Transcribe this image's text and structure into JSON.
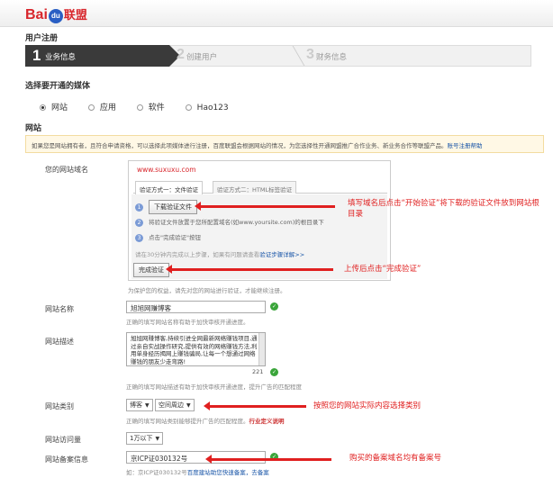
{
  "brand": {
    "logo_text_a": "Bai",
    "logo_paw": "du",
    "logo_cn": "联盟"
  },
  "page_title": "用户注册",
  "steps": [
    {
      "num": "1",
      "label": "业务信息"
    },
    {
      "num": "2",
      "label": "创建用户"
    },
    {
      "num": "3",
      "label": "财务信息"
    }
  ],
  "media": {
    "title": "选择要开通的媒体",
    "options": [
      "网站",
      "应用",
      "软件",
      "Hao123"
    ],
    "selected": "网站"
  },
  "site": {
    "title": "网站",
    "notice": "如果您是网站拥有者，且符合申请资格，可以选择此项媒体进行注册，百度联盟会根据网站的情况，为您选择性开通网盟推广合作业务、新业务合作等联盟产品。",
    "notice_link": "账号注册帮助"
  },
  "domain_field": {
    "label": "您的网站域名",
    "url": "www.suxuxu.com",
    "tab1": "验证方式一：文件验证",
    "tab2": "验证方式二：HTML标签验证",
    "step1_num": "1",
    "step1_button": "下载验证文件",
    "step2_num": "2",
    "step2_text": "将验证文件放置于您所配置域名(如www.yoursite.com)的根目录下",
    "step3_num": "3",
    "step3_text": "点击\"完成验证\"按钮",
    "tip": "请在30分钟内完成以上步骤，如果有问题请查看",
    "tip_link": "验证步骤详解>>",
    "complete_button": "完成验证",
    "protect_hint": "为保护您的权益，请先对您的网站进行验证，才能继续注册。"
  },
  "annotations": {
    "verify_note": "填写域名后点击“开始验证”将下载的验证文件放到网站根目录",
    "complete_note": "上传后点击“完成验证”",
    "category_note": "按照您的网站实际内容选择类别",
    "icp_note": "购买的备案域名均有备案号"
  },
  "site_name": {
    "label": "网站名称",
    "value": "旭旭网赚博客",
    "hint": "正确的填写网站名称有助于加快审核开通进度。"
  },
  "site_desc": {
    "label": "网站描述",
    "value": "旭旭网赚博客,持续引进全网最新网络赚钱项目,通过亲自实战操作研究,提供有效的网络赚钱方法,利用单身经历揭网上赚钱骗局,让每一个想通过网络赚钱的朋友少走弯路!",
    "count": "221",
    "hint": "正确的填写网站描述有助于加快审核开通进度，提升广告的匹配程度"
  },
  "site_category": {
    "label": "网站类别",
    "primary": "博客",
    "secondary": "空间周边",
    "hint": "正确的填写网站类别能够提升广告的匹配程度。",
    "hint_link": "行业定义说明"
  },
  "site_traffic": {
    "label": "网站访问量",
    "value": "1万以下"
  },
  "icp": {
    "label": "网站备案信息",
    "value": "京ICP证030132号",
    "hint": "如：京ICP证030132号",
    "hint_link1": "百度建站助您快速备案，",
    "hint_link2": "去备案"
  },
  "icons": [
    "radio-icon",
    "check-icon",
    "chevron-down-icon",
    "arrow-left-icon"
  ]
}
